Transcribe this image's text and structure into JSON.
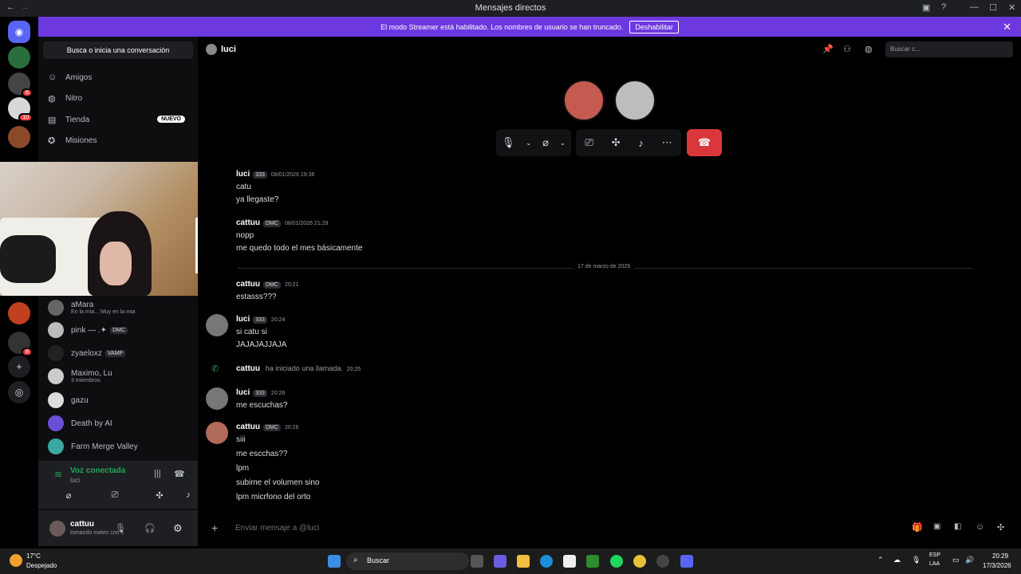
{
  "window": {
    "title": "Mensajes directos"
  },
  "banner": {
    "text": "El modo Streamer está habilitado. Los nombres de usuario se han truncado.",
    "button": "Deshabilitar"
  },
  "guilds": {
    "badges": [
      "6",
      "10",
      "8"
    ]
  },
  "sidebar": {
    "search": "Busca o inicia una conversación",
    "nav": [
      {
        "label": "Amigos",
        "icon": "friends-icon"
      },
      {
        "label": "Nitro",
        "icon": "nitro-icon"
      },
      {
        "label": "Tienda",
        "icon": "shop-icon",
        "badge": "NUEVO"
      },
      {
        "label": "Misiones",
        "icon": "quests-icon"
      }
    ],
    "dms": [
      {
        "name": "aMara",
        "sub": "En la mia... Muy en la mia"
      },
      {
        "name": "pink — .✦",
        "tag": "DMC"
      },
      {
        "name": "zyaeloxz",
        "tag": "VAMP"
      },
      {
        "name": "Maximo, Lu",
        "sub": "3 miembros"
      },
      {
        "name": "gazu"
      },
      {
        "name": "Death by AI"
      },
      {
        "name": "Farm Merge Valley"
      }
    ]
  },
  "voice": {
    "status": "Voz conectada",
    "channel": "luci"
  },
  "user": {
    "name": "cattuu",
    "status": "tomando mates con s"
  },
  "header": {
    "name": "luci",
    "search_placeholder": "Buscar c..."
  },
  "messages": [
    {
      "author": "luci",
      "tag": "333",
      "time": "08/01/2026 19:36",
      "lines": [
        "catu",
        "ya llegaste?"
      ]
    },
    {
      "author": "cattuu",
      "tag": "DMC",
      "time": "08/01/2026 21:29",
      "lines": [
        "nopp",
        "me quedo todo el mes básicamente"
      ]
    },
    {
      "author": "cattuu",
      "tag": "DMC",
      "time": "20:21",
      "lines": [
        "estasss???"
      ]
    },
    {
      "author": "luci",
      "tag": "333",
      "time": "20:24",
      "lines": [
        "si catu si",
        "JAJAJAJJAJA"
      ]
    },
    {
      "author": "luci",
      "tag": "333",
      "time": "20:26",
      "lines": [
        "me escuchas?"
      ]
    },
    {
      "author": "cattuu",
      "tag": "DMC",
      "time": "20:26",
      "lines": [
        "siii",
        "me escchas??",
        "lpm",
        "subime el volumen sino",
        "lpm micrfono del orto"
      ]
    }
  ],
  "divider": "17 de marzo de 2026",
  "call_event": {
    "author": "cattuu",
    "text": "ha iniciado una llamada.",
    "time": "20:25"
  },
  "composer": {
    "placeholder": "Enviar mensaje a @luci"
  },
  "taskbar": {
    "weather_temp": "17°C",
    "weather_desc": "Despejado",
    "search": "Buscar",
    "lang1": "ESP",
    "lang2": "LAA",
    "time": "20:29",
    "date": "17/3/2026"
  },
  "colors": {
    "accent": "#5865f2",
    "banner": "#6d38e0",
    "hangup": "#da373c"
  }
}
